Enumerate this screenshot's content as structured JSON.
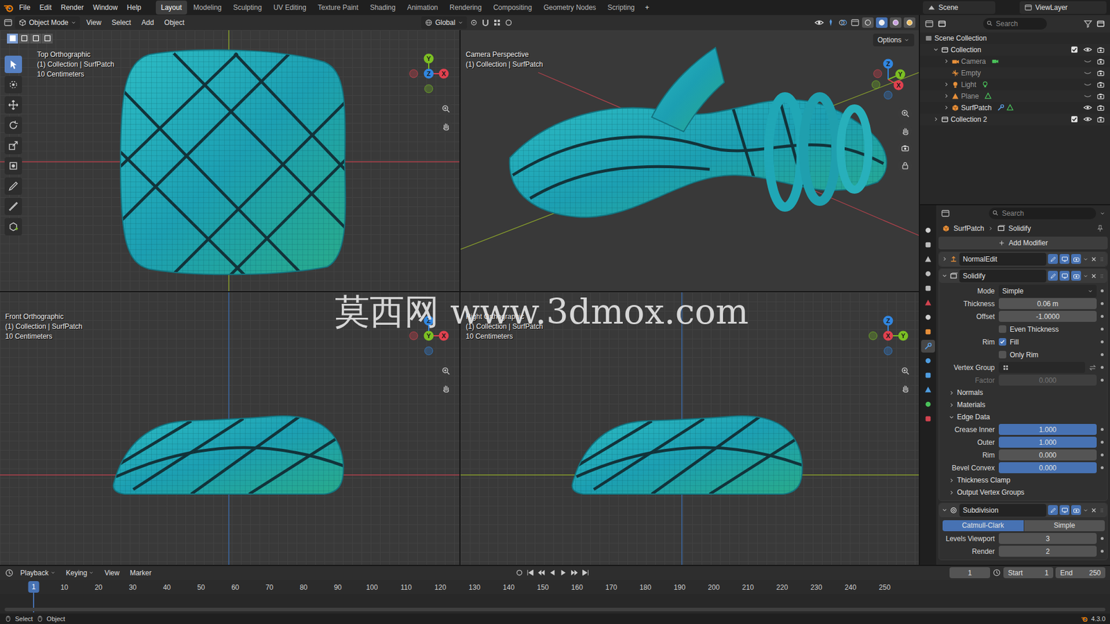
{
  "topbar": {
    "menus": [
      "File",
      "Edit",
      "Render",
      "Window",
      "Help"
    ],
    "workspaces": [
      {
        "label": "Layout",
        "selected": true
      },
      {
        "label": "Modeling",
        "selected": false
      },
      {
        "label": "Sculpting",
        "selected": false
      },
      {
        "label": "UV Editing",
        "selected": false
      },
      {
        "label": "Texture Paint",
        "selected": false
      },
      {
        "label": "Shading",
        "selected": false
      },
      {
        "label": "Animation",
        "selected": false
      },
      {
        "label": "Rendering",
        "selected": false
      },
      {
        "label": "Compositing",
        "selected": false
      },
      {
        "label": "Geometry Nodes",
        "selected": false
      },
      {
        "label": "Scripting",
        "selected": false
      }
    ],
    "add": "+",
    "scene": "Scene",
    "view_layer": "ViewLayer"
  },
  "viewport_header": {
    "mode": "Object Mode",
    "menus": [
      "View",
      "Select",
      "Add",
      "Object"
    ],
    "orientation": "Global",
    "shading": [
      {
        "selected": false
      },
      {
        "selected": true
      },
      {
        "selected": false
      },
      {
        "selected": false
      }
    ]
  },
  "select_modes": [
    {
      "selected": true
    },
    {
      "selected": false
    },
    {
      "selected": false
    },
    {
      "selected": false
    }
  ],
  "tools": [
    {
      "selected": true
    },
    {
      "selected": false
    },
    {
      "selected": false
    },
    {
      "selected": false
    },
    {
      "selected": false
    },
    {
      "selected": false
    },
    {
      "selected": false
    },
    {
      "selected": false
    },
    {
      "selected": false
    }
  ],
  "viewports": [
    {
      "kind": "top",
      "title": "Top Orthographic",
      "context": "(1) Collection | SurfPatch",
      "scale": "10 Centimeters",
      "axes": [
        {
          "label": "Y",
          "color": "#7cbf23"
        },
        {
          "label": "X",
          "color": "#e0414f"
        },
        {
          "label": "Z",
          "color": "#3186e0"
        }
      ]
    },
    {
      "kind": "camera",
      "title": "Camera Perspective",
      "context": "(1) Collection | SurfPatch",
      "options": "Options",
      "axes": [
        {
          "label": "Z",
          "color": "#3186e0"
        },
        {
          "label": "Y",
          "color": "#7cbf23"
        },
        {
          "label": "X",
          "color": "#e0414f"
        }
      ]
    },
    {
      "kind": "front",
      "title": "Front Orthographic",
      "context": "(1) Collection | SurfPatch",
      "scale": "10 Centimeters",
      "axes": [
        {
          "label": "Z",
          "color": "#3186e0"
        },
        {
          "label": "X",
          "color": "#e0414f"
        },
        {
          "label": "Y",
          "color": "#7cbf23"
        }
      ]
    },
    {
      "kind": "right",
      "title": "Right Orthographic",
      "context": "(1) Collection | SurfPatch",
      "scale": "10 Centimeters",
      "axes": [
        {
          "label": "Z",
          "color": "#3186e0"
        },
        {
          "label": "Y",
          "color": "#7cbf23"
        },
        {
          "label": "X",
          "color": "#e0414f"
        }
      ]
    }
  ],
  "watermark": "莫西网 www.3dmox.com",
  "outliner": {
    "search": "Search",
    "root": "Scene Collection",
    "items": [
      {
        "label": "Collection",
        "kind": "collection",
        "depth": 1,
        "expanded": true,
        "checked": true,
        "visible": true
      },
      {
        "label": "Camera",
        "kind": "camera",
        "depth": 2,
        "expanded": false,
        "visible": false
      },
      {
        "label": "Empty",
        "kind": "empty",
        "depth": 2,
        "visible": false
      },
      {
        "label": "Light",
        "kind": "light",
        "depth": 2,
        "expanded": false,
        "visible": false
      },
      {
        "label": "Plane",
        "kind": "mesh",
        "depth": 2,
        "expanded": false,
        "visible": false
      },
      {
        "label": "SurfPatch",
        "kind": "surfpatch",
        "depth": 2,
        "expanded": false,
        "visible": true
      },
      {
        "label": "Collection 2",
        "kind": "collection",
        "depth": 1,
        "expanded": false,
        "checked": true,
        "visible": true
      }
    ]
  },
  "properties": {
    "tabs": [
      {
        "selected": false,
        "color": "#cfcfcf"
      },
      {
        "selected": false,
        "color": "#bdbdbd"
      },
      {
        "selected": false,
        "color": "#bdbdbd"
      },
      {
        "selected": false,
        "color": "#bdbdbd"
      },
      {
        "selected": false,
        "color": "#bdbdbd"
      },
      {
        "selected": false,
        "color": "#d2434f"
      },
      {
        "selected": false,
        "color": "#cfcfcf"
      },
      {
        "selected": false,
        "color": "#e8903a"
      },
      {
        "selected": true,
        "color": "#5a9be0"
      },
      {
        "selected": false,
        "color": "#4f9de0"
      },
      {
        "selected": false,
        "color": "#4f9de0"
      },
      {
        "selected": false,
        "color": "#4f9de0"
      },
      {
        "selected": false,
        "color": "#4ac25a"
      },
      {
        "selected": false,
        "color": "#d2434f"
      }
    ],
    "search": "Search",
    "breadcrumb": [
      "SurfPatch",
      "Solidify"
    ],
    "add_modifier": "Add Modifier",
    "modifiers": [
      {
        "name": "NormalEdit",
        "kind": "normaledit",
        "expanded": false,
        "rows": []
      },
      {
        "name": "Solidify",
        "kind": "solidify",
        "expanded": true,
        "rows": [
          {
            "kind": "dropdown",
            "label": "Mode",
            "value": "Simple"
          },
          {
            "kind": "field",
            "label": "Thickness",
            "value": "0.06 m",
            "disabled": false
          },
          {
            "kind": "field",
            "label": "Offset",
            "value": "-1.0000",
            "disabled": false
          },
          {
            "kind": "check",
            "label": "",
            "text": "Even Thickness",
            "checked": false
          },
          {
            "kind": "check",
            "label": "Rim",
            "text": "Fill",
            "checked": true
          },
          {
            "kind": "check",
            "label": "",
            "text": "Only Rim",
            "checked": false
          },
          {
            "kind": "group",
            "label": "Vertex Group"
          },
          {
            "kind": "field",
            "label": "Factor",
            "value": "0.000",
            "disabled": true
          },
          {
            "kind": "section",
            "label": "Normals",
            "expanded": false
          },
          {
            "kind": "section",
            "label": "Materials",
            "expanded": false
          },
          {
            "kind": "section",
            "label": "Edge Data",
            "expanded": true
          },
          {
            "kind": "slider",
            "label": "Crease Inner",
            "value": "1.000",
            "level": 1
          },
          {
            "kind": "slider",
            "label": "Outer",
            "value": "1.000",
            "level": 1
          },
          {
            "kind": "slider",
            "label": "Rim",
            "value": "0.000",
            "level": 0
          },
          {
            "kind": "slider",
            "label": "Bevel Convex",
            "value": "0.000",
            "level": 1
          },
          {
            "kind": "section",
            "label": "Thickness Clamp",
            "expanded": false
          },
          {
            "kind": "section",
            "label": "Output Vertex Groups",
            "expanded": false
          }
        ]
      },
      {
        "name": "Subdivision",
        "kind": "subdivision",
        "expanded": true,
        "rows": [
          {
            "kind": "toggle",
            "options": [
              {
                "label": "Catmull-Clark",
                "selected": true
              },
              {
                "label": "Simple",
                "selected": false
              }
            ]
          },
          {
            "kind": "field",
            "label": "Levels Viewport",
            "value": "3",
            "disabled": false
          },
          {
            "kind": "field",
            "label": "Render",
            "value": "2",
            "disabled": false
          }
        ]
      }
    ]
  },
  "timeline": {
    "menus": [
      {
        "label": "Playback",
        "kind": "dropdown"
      },
      {
        "label": "Keying",
        "kind": "dropdown"
      },
      {
        "label": "View",
        "kind": "menu"
      },
      {
        "label": "Marker",
        "kind": "menu"
      }
    ],
    "frame": "1",
    "start_label": "Start",
    "start": "1",
    "end_label": "End",
    "end": "250",
    "ticks": [
      "1",
      "10",
      "20",
      "30",
      "40",
      "50",
      "60",
      "70",
      "80",
      "90",
      "100",
      "110",
      "120",
      "130",
      "140",
      "150",
      "160",
      "170",
      "180",
      "190",
      "200",
      "210",
      "220",
      "230",
      "240",
      "250"
    ],
    "playhead": "1"
  },
  "status_bar": {
    "items": [
      "Select",
      "Object"
    ],
    "version": "4.3.0"
  }
}
